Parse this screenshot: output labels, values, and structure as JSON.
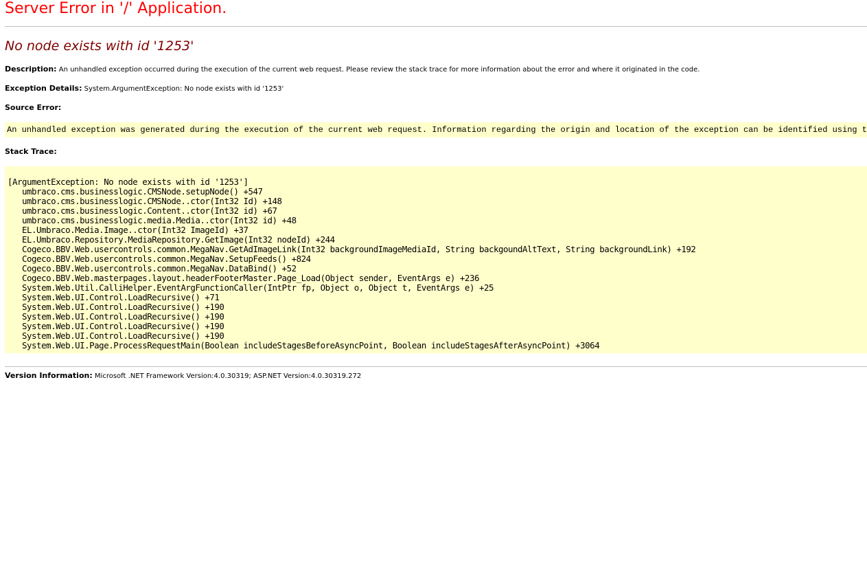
{
  "header": {
    "title": "Server Error in '/' Application.",
    "error_message": "No node exists with id '1253'"
  },
  "description": {
    "label": "Description:",
    "text": "An unhandled exception occurred during the execution of the current web request. Please review the stack trace for more information about the error and where it originated in the code."
  },
  "exception_details": {
    "label": "Exception Details:",
    "text": "System.ArgumentException: No node exists with id '1253'"
  },
  "source_error": {
    "label": "Source Error:",
    "text": "An unhandled exception was generated during the execution of the current web request. Information regarding the origin and location of the exception can be identified using the exception stack trace below."
  },
  "stack_trace": {
    "label": "Stack Trace:",
    "lines": [
      "[ArgumentException: No node exists with id '1253']",
      "   umbraco.cms.businesslogic.CMSNode.setupNode() +547",
      "   umbraco.cms.businesslogic.CMSNode..ctor(Int32 Id) +148",
      "   umbraco.cms.businesslogic.Content..ctor(Int32 id) +67",
      "   umbraco.cms.businesslogic.media.Media..ctor(Int32 id) +48",
      "   EL.Umbraco.Media.Image..ctor(Int32 ImageId) +37",
      "   EL.Umbraco.Repository.MediaRepository.GetImage(Int32 nodeId) +244",
      "   Cogeco.BBV.Web.usercontrols.common.MegaNav.GetAdImageLink(Int32 backgroundImageMediaId, String backgoundAltText, String backgroundLink) +192",
      "   Cogeco.BBV.Web.usercontrols.common.MegaNav.SetupFeeds() +824",
      "   Cogeco.BBV.Web.usercontrols.common.MegaNav.DataBind() +52",
      "   Cogeco.BBV.Web.masterpages.layout.headerFooterMaster.Page_Load(Object sender, EventArgs e) +236",
      "   System.Web.Util.CalliHelper.EventArgFunctionCaller(IntPtr fp, Object o, Object t, EventArgs e) +25",
      "   System.Web.UI.Control.LoadRecursive() +71",
      "   System.Web.UI.Control.LoadRecursive() +190",
      "   System.Web.UI.Control.LoadRecursive() +190",
      "   System.Web.UI.Control.LoadRecursive() +190",
      "   System.Web.UI.Control.LoadRecursive() +190",
      "   System.Web.UI.Page.ProcessRequestMain(Boolean includeStagesBeforeAsyncPoint, Boolean includeStagesAfterAsyncPoint) +3064"
    ]
  },
  "version_information": {
    "label": "Version Information:",
    "text": "Microsoft .NET Framework Version:4.0.30319; ASP.NET Version:4.0.30319.272"
  },
  "colors": {
    "title_red": "#ff0000",
    "error_maroon": "#800000",
    "code_background": "#ffffcc",
    "rule_gray": "#c0c0c0"
  }
}
